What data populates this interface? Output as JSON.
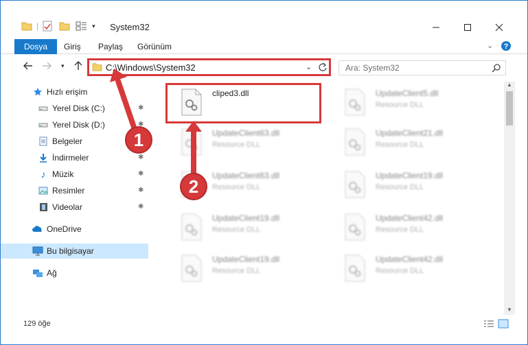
{
  "window": {
    "title": "System32"
  },
  "ribbon": {
    "tabs": [
      "Dosya",
      "Giriş",
      "Paylaş",
      "Görünüm"
    ]
  },
  "address": {
    "path": "C:\\Windows\\System32",
    "search_placeholder": "Ara: System32"
  },
  "nav": {
    "items": [
      {
        "label": "Hızlı erişim",
        "icon": "star-icon"
      },
      {
        "label": "Yerel Disk (C:)",
        "icon": "drive-icon",
        "pinned": true
      },
      {
        "label": "Yerel Disk (D:)",
        "icon": "drive-icon",
        "pinned": true
      },
      {
        "label": "Belgeler",
        "icon": "documents-icon",
        "pinned": true
      },
      {
        "label": "İndirmeler",
        "icon": "downloads-icon",
        "pinned": true
      },
      {
        "label": "Müzik",
        "icon": "music-icon",
        "pinned": true
      },
      {
        "label": "Resimler",
        "icon": "pictures-icon",
        "pinned": true
      },
      {
        "label": "Videolar",
        "icon": "videos-icon",
        "pinned": true
      },
      {
        "label": "OneDrive",
        "icon": "onedrive-icon"
      },
      {
        "label": "Bu bilgisayar",
        "icon": "computer-icon",
        "selected": true
      },
      {
        "label": "Ağ",
        "icon": "network-icon"
      }
    ]
  },
  "files": [
    {
      "name": "cliped3.dll",
      "type": ""
    },
    {
      "name": "UpdateClient5.dll",
      "type": "Resource DLL"
    },
    {
      "name": "UpdateClient63.dll",
      "type": "Resource DLL"
    },
    {
      "name": "UpdateClient21.dll",
      "type": "Resource DLL"
    },
    {
      "name": "UpdateClient63.dll",
      "type": "Resource DLL"
    },
    {
      "name": "UpdateClient19.dll",
      "type": "Resource DLL"
    },
    {
      "name": "UpdateClient19.dll",
      "type": "Resource DLL"
    },
    {
      "name": "UpdateClient42.dll",
      "type": "Resource DLL"
    },
    {
      "name": "UpdateClient19.dll",
      "type": "Resource DLL"
    },
    {
      "name": "UpdateClient42.dll",
      "type": "Resource DLL"
    }
  ],
  "status": {
    "count": "129 öğe"
  },
  "callouts": [
    "1",
    "2"
  ],
  "colors": {
    "accent": "#1979ca",
    "highlight": "#d6393a",
    "selected": "#cce8ff"
  }
}
